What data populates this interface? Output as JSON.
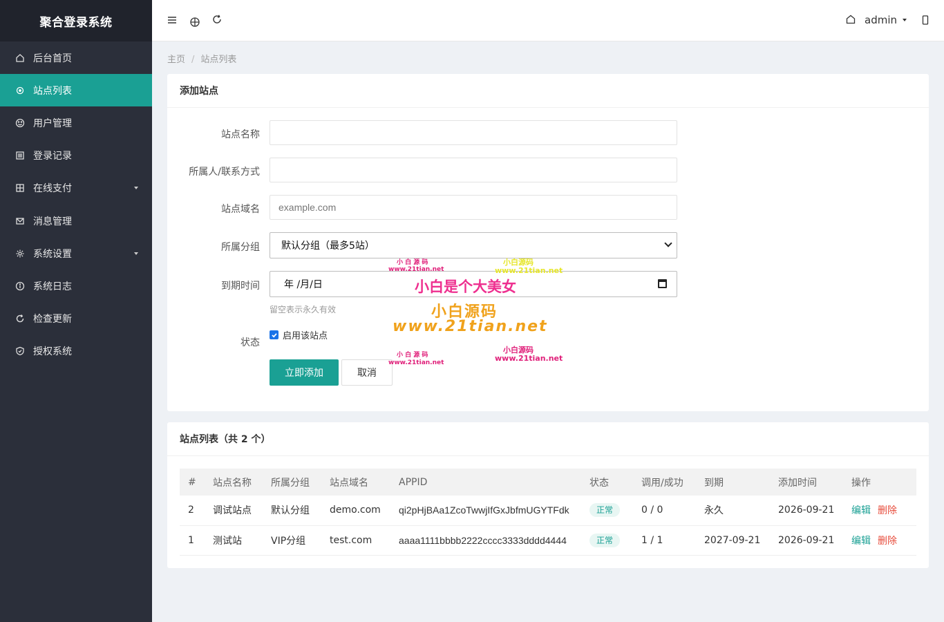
{
  "app": {
    "title": "聚合登录系统"
  },
  "sidebar": {
    "items": [
      {
        "label": "后台首页",
        "icon": "home-icon"
      },
      {
        "label": "站点列表",
        "icon": "circle-icon",
        "active": true
      },
      {
        "label": "用户管理",
        "icon": "smile-icon"
      },
      {
        "label": "登录记录",
        "icon": "list-icon"
      },
      {
        "label": "在线支付",
        "icon": "grid-icon",
        "has_submenu": true
      },
      {
        "label": "消息管理",
        "icon": "mail-icon"
      },
      {
        "label": "系统设置",
        "icon": "gear-icon",
        "has_submenu": true
      },
      {
        "label": "系统日志",
        "icon": "info-icon"
      },
      {
        "label": "检查更新",
        "icon": "refresh-icon"
      },
      {
        "label": "授权系统",
        "icon": "shield-icon"
      }
    ]
  },
  "header": {
    "icons": [
      "menu-icon",
      "globe-icon",
      "refresh-icon"
    ],
    "home_icon": "home-icon",
    "user": "admin",
    "phone_icon": "phone-icon"
  },
  "breadcrumb": {
    "home": "主页",
    "current": "站点列表"
  },
  "form": {
    "title": "添加站点",
    "name_label": "站点名称",
    "name_value": "",
    "owner_label": "所属人/联系方式",
    "owner_value": "",
    "domain_label": "站点域名",
    "domain_placeholder": "example.com",
    "group_label": "所属分组",
    "group_value": "默认分组（最多5站）",
    "expire_label": "到期时间",
    "expire_value": "年 /月/日",
    "expire_hint": "留空表示永久有效",
    "status_label": "状态",
    "status_checkbox": "启用该站点",
    "submit": "立即添加",
    "cancel": "取消"
  },
  "watermark": {
    "big": "小白是个大美女",
    "brand": "小白源码",
    "url": "www.21tian.net",
    "small_brand": "小 白 源 码",
    "small_url": "www.21tian.net"
  },
  "list": {
    "title": "站点列表（共 2 个）",
    "columns": [
      "#",
      "站点名称",
      "所属分组",
      "站点域名",
      "APPID",
      "状态",
      "调用/成功",
      "到期",
      "添加时间",
      "操作"
    ],
    "rows": [
      {
        "id": "2",
        "name": "调试站点",
        "group": "默认分组",
        "domain": "demo.com",
        "appid": "qi2pHjBAa1ZcoTwwjIfGxJbfmUGYTFdk",
        "status": "正常",
        "calls": "0 / 0",
        "expire": "永久",
        "added": "2026-09-21",
        "edit": "编辑",
        "delete": "删除"
      },
      {
        "id": "1",
        "name": "测试站",
        "group": "VIP分组",
        "domain": "test.com",
        "appid": "aaaa1111bbbb2222cccc3333dddd4444",
        "status": "正常",
        "calls": "1 / 1",
        "expire": "2027-09-21",
        "added": "2026-09-21",
        "edit": "编辑",
        "delete": "删除"
      }
    ]
  },
  "colors": {
    "accent": "#1aa094",
    "sidebar_bg": "#2b2f3a",
    "danger": "#e74c3c"
  }
}
